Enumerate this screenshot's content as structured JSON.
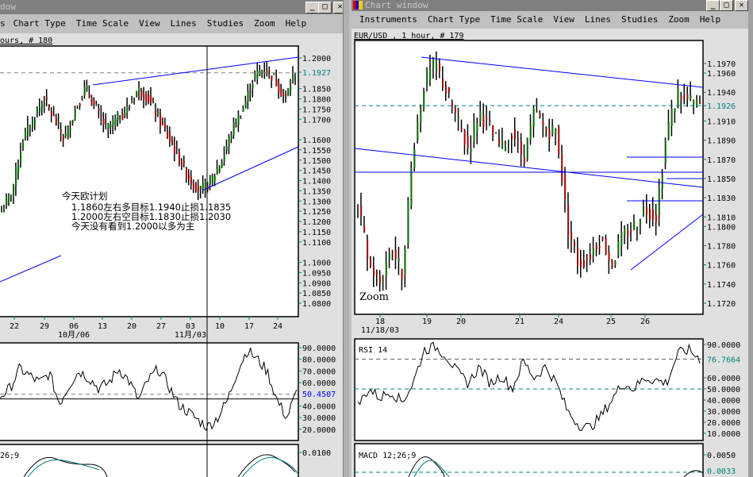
{
  "left_window": {
    "title": "dow",
    "menu": [
      "s",
      "Chart Type",
      "Time Scale",
      "View",
      "Lines",
      "Studies",
      "Zoom",
      "Help"
    ],
    "symbol_label": "ours, # 180",
    "annotation": [
      "今天欧计划",
      "1.1860左右多目标1.1940止损1.1835",
      "1.2000左右空目标1.1830止损1.2030",
      "今天没有看到1.2000以多为主"
    ],
    "price_ticks": [
      "1.2000",
      "1.1850",
      "1.1800",
      "1.1750",
      "1.1700",
      "1.1600",
      "1.1550",
      "1.1500",
      "1.1450",
      "1.1400",
      "1.1350",
      "1.1300",
      "1.1250",
      "1.1200",
      "1.1150",
      "1.1100",
      "1.1000",
      "1.0950",
      "1.0900",
      "1.0850",
      "1.0800"
    ],
    "last_price": "1.1927",
    "date_ticks": [
      "22",
      "29",
      "06",
      "13",
      "20",
      "27",
      "03",
      "10",
      "17",
      "24"
    ],
    "month_labels": [
      "10月/06",
      "11月/03"
    ],
    "rsi_ticks": [
      "90.0000",
      "80.0000",
      "70.0000",
      "60.0000",
      "40.0000",
      "30.0000",
      "20.0000"
    ],
    "rsi_last": "50.4507",
    "macd_label": "26;9",
    "macd_tick": "0.0100"
  },
  "right_window": {
    "title": "Chart window",
    "menu": [
      "Instruments",
      "Chart Type",
      "Time Scale",
      "View",
      "Lines",
      "Studies",
      "Zoom",
      "Help"
    ],
    "symbol_label": "EUR/USD , 1 hour, # 179",
    "zoom_label": "Zoom",
    "price_ticks": [
      "1.1970",
      "1.1960",
      "1.1940",
      "1.1910",
      "1.1890",
      "1.1870",
      "1.1850",
      "1.1830",
      "1.1810",
      "1.1800",
      "1.1780",
      "1.1760",
      "1.1740",
      "1.1720"
    ],
    "last_price": "1.1926",
    "date_ticks": [
      "18",
      "19",
      "20",
      "21",
      "24",
      "25",
      "26"
    ],
    "date_sub": "11/18/03",
    "rsi_label": "RSI 14",
    "rsi_ticks": [
      "90.0000",
      "60.0000",
      "50.0000",
      "40.0000",
      "30.0000",
      "20.0000",
      "10.0000"
    ],
    "rsi_last": "76.7664",
    "macd_label": "MACD 12;26;9",
    "macd_tick": "0.0050",
    "macd_last": "0.0033"
  },
  "colors": {
    "up": "#008000",
    "down": "#cc0000",
    "trend": "#0000ff",
    "teal": "#008080"
  },
  "chart_data": [
    {
      "type": "candlestick",
      "name": "left-price",
      "bars": 125,
      "closes": [
        1.125,
        1.135,
        1.16,
        1.17,
        1.18,
        1.17,
        1.16,
        1.175,
        1.185,
        1.175,
        1.165,
        1.17,
        1.175,
        1.185,
        1.18,
        1.17,
        1.16,
        1.15,
        1.14,
        1.135,
        1.14,
        1.15,
        1.165,
        1.175,
        1.19,
        1.195,
        1.19,
        1.18,
        1.193
      ],
      "rsi": [
        48,
        55,
        72,
        66,
        60,
        68,
        42,
        58,
        70,
        64,
        55,
        60,
        72,
        62,
        45,
        62,
        72,
        58,
        42,
        35,
        28,
        22,
        30,
        45,
        70,
        88,
        80,
        70,
        45,
        30,
        52
      ]
    },
    {
      "type": "candlestick",
      "name": "eurusd-1h",
      "bars": 110,
      "closes": [
        1.182,
        1.176,
        1.174,
        1.178,
        1.175,
        1.188,
        1.195,
        1.197,
        1.194,
        1.191,
        1.188,
        1.192,
        1.19,
        1.188,
        1.19,
        1.187,
        1.192,
        1.19,
        1.19,
        1.18,
        1.176,
        1.177,
        1.179,
        1.176,
        1.179,
        1.18,
        1.182,
        1.181,
        1.19,
        1.194,
        1.193,
        1.1926
      ],
      "rsi": [
        35,
        50,
        42,
        48,
        38,
        55,
        85,
        88,
        80,
        65,
        55,
        70,
        55,
        62,
        50,
        75,
        60,
        70,
        55,
        30,
        18,
        15,
        25,
        40,
        55,
        50,
        60,
        58,
        55,
        82,
        85,
        77
      ]
    }
  ]
}
